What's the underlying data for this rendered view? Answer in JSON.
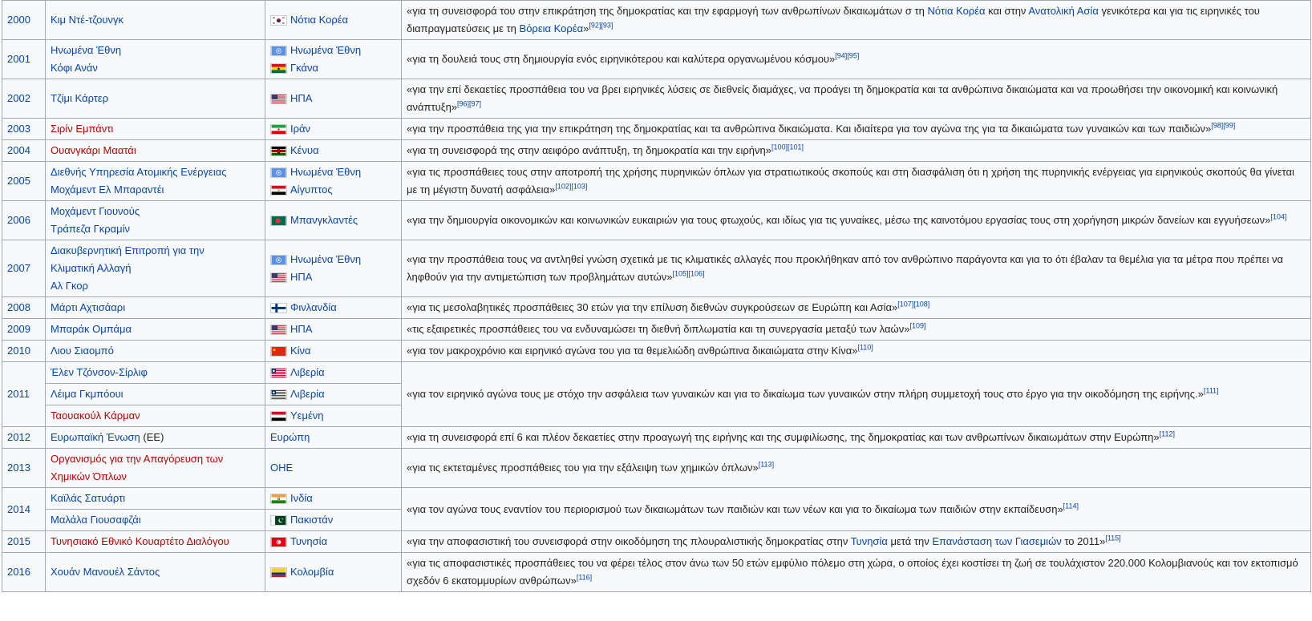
{
  "rows": [
    {
      "year": "2000",
      "names": [
        {
          "text": "Κιμ Ντέ-τζουνγκ",
          "cls": "blue"
        }
      ],
      "countries": [
        {
          "flag": "south-korea-flag",
          "text": "Νότια Κορέα"
        }
      ],
      "reason": [
        {
          "t": "«για τη συνεισφορά του στην επικράτηση της δημοκρατίας και την εφαρμογή των ανθρωπίνων δικαιωμάτων σ τη "
        },
        {
          "t": "Νότια Κορέα",
          "link": true
        },
        {
          "t": " και στην "
        },
        {
          "t": "Ανατολική Ασία",
          "link": true
        },
        {
          "t": " γενικότερα και για τις ειρηνικές του διαπραγματεύσεις με τη "
        },
        {
          "t": "Βόρεια Κορέα",
          "link": true
        },
        {
          "t": "»"
        }
      ],
      "refs": "[92][93]"
    },
    {
      "year": "2001",
      "names": [
        {
          "text": "Ηνωμένα Έθνη",
          "cls": "blue"
        },
        {
          "text": "Κόφι Ανάν",
          "cls": "blue"
        }
      ],
      "countries": [
        {
          "flag": "un-flag",
          "text": "Ηνωμένα Έθνη"
        },
        {
          "flag": "ghana-flag",
          "text": "Γκάνα"
        }
      ],
      "reason": [
        {
          "t": "«για τη δουλειά τους στη δημιουργία ενός ειρηνικότερου και καλύτερα οργανωμένου κόσμου»"
        }
      ],
      "refs": "[94][95]"
    },
    {
      "year": "2002",
      "names": [
        {
          "text": "Τζίμι Κάρτερ",
          "cls": "blue"
        }
      ],
      "countries": [
        {
          "flag": "usa-flag",
          "text": "ΗΠΑ"
        }
      ],
      "reason": [
        {
          "t": "«για την επί δεκαετίες προσπάθεια του να βρει ειρηνικές λύσεις σε διεθνείς διαμάχες, να προάγει τη δημοκρατία και τα ανθρώπινα δικαιώματα και να προωθήσει την οικονομική και κοινωνική ανάπτυξη»"
        }
      ],
      "refs": "[96][97]"
    },
    {
      "year": "2003",
      "names": [
        {
          "text": "Σιρίν Εμπάντι",
          "cls": "red"
        }
      ],
      "countries": [
        {
          "flag": "iran-flag",
          "text": "Ιράν"
        }
      ],
      "reason": [
        {
          "t": "«για την προσπάθεια της για την επικράτηση της δημοκρατίας και τα ανθρώπινα δικαιώματα. Και ιδιαίτερα για τον αγώνα της για τα δικαιώματα των γυναικών και των παιδιών»"
        }
      ],
      "refs": "[98][99]"
    },
    {
      "year": "2004",
      "names": [
        {
          "text": "Ουανγκάρι Μαατάι",
          "cls": "red"
        }
      ],
      "countries": [
        {
          "flag": "kenya-flag",
          "text": "Κένυα"
        }
      ],
      "reason": [
        {
          "t": "«για τη συνεισφορά της στην αειφόρο ανάπτυξη, τη δημοκρατία και την ειρήνη»"
        }
      ],
      "refs": "[100][101]"
    },
    {
      "year": "2005",
      "names": [
        {
          "text": "Διεθνής Υπηρεσία Ατομικής Ενέργειας",
          "cls": "blue"
        },
        {
          "text": "Μοχάμεντ Ελ Μπαραντέι",
          "cls": "blue"
        }
      ],
      "countries": [
        {
          "flag": "un-flag",
          "text": "Ηνωμένα Έθνη"
        },
        {
          "flag": "egypt-flag",
          "text": "Αίγυπτος"
        }
      ],
      "reason": [
        {
          "t": "«για τις προσπάθειες τους στην αποτροπή της χρήσης πυρηνικών όπλων για στρατιωτικούς σκοπούς και στη διασφάλιση ότι η χρήση της πυρηνικής ενέργειας για ειρηνικούς σκοπούς θα γίνεται με τη μέγιστη δυνατή ασφάλεια»"
        }
      ],
      "refs": "[102][103]"
    },
    {
      "year": "2006",
      "names": [
        {
          "text": "Μοχάμεντ Γιουνούς",
          "cls": "blue"
        },
        {
          "text": "Τράπεζα Γκραμίν",
          "cls": "blue"
        }
      ],
      "countries": [
        {
          "flag": "bangladesh-flag",
          "text": "Μπανγκλαντές"
        }
      ],
      "reason": [
        {
          "t": "«για την δημιουργία οικονομικών και κοινωνικών ευκαιριών για τους φτωχούς, και ιδίως για τις γυναίκες, μέσω της καινοτόμου εργασίας τους στη χορήγηση μικρών δανείων και εγγυήσεων»"
        }
      ],
      "refs": "[104]"
    },
    {
      "year": "2007",
      "names": [
        {
          "text": "Διακυβερνητική Επιτροπή για την",
          "cls": "blue"
        },
        {
          "text": "Κλιματική Αλλαγή",
          "cls": "blue"
        },
        {
          "text": "Αλ Γκορ",
          "cls": "blue"
        }
      ],
      "countries": [
        {
          "flag": "un-flag",
          "text": "Ηνωμένα Έθνη"
        },
        {
          "flag": "usa-flag",
          "text": "ΗΠΑ"
        }
      ],
      "reason": [
        {
          "t": "«για την προσπάθεια τους να αντληθεί γνώση σχετικά με τις κλιματικές αλλαγές που προκλήθηκαν από τον ανθρώπινο παράγοντα και για το ότι έβαλαν τα θεμέλια για τα μέτρα που πρέπει να ληφθούν για την αντιμετώπιση των προβλημάτων αυτών»"
        }
      ],
      "refs": "[105][106]"
    },
    {
      "year": "2008",
      "names": [
        {
          "text": "Μάρτι Αχτισάαρι",
          "cls": "blue"
        }
      ],
      "countries": [
        {
          "flag": "finland-flag",
          "text": "Φινλανδία"
        }
      ],
      "reason": [
        {
          "t": "«για τις μεσολαβητικές προσπάθειες 30 ετών για την επίλυση διεθνών συγκρούσεων σε Ευρώπη και Ασία»"
        }
      ],
      "refs": "[107][108]"
    },
    {
      "year": "2009",
      "names": [
        {
          "text": "Μπαράκ Ομπάμα",
          "cls": "blue"
        }
      ],
      "countries": [
        {
          "flag": "usa-flag",
          "text": "ΗΠΑ"
        }
      ],
      "reason": [
        {
          "t": "«τις εξαιρετικές προσπάθειες του να ενδυναμώσει τη διεθνή διπλωματία και τη συνεργασία μεταξύ των λαών»"
        }
      ],
      "refs": "[109]"
    },
    {
      "year": "2010",
      "names": [
        {
          "text": "Λιου Σιαομπό",
          "cls": "blue"
        }
      ],
      "countries": [
        {
          "flag": "china-flag",
          "text": "Κίνα"
        }
      ],
      "reason": [
        {
          "t": "«για τον μακροχρόνιο και ειρηνικό αγώνα του για τα θεμελιώδη ανθρώπινα δικαιώματα στην Κίνα»"
        }
      ],
      "refs": "[110]"
    },
    {
      "year": "2012",
      "names": [
        {
          "text": "Ευρωπαϊκή Ένωση",
          "cls": "blue",
          "suffix": " (ΕΕ)"
        }
      ],
      "countries": [
        {
          "flag": "",
          "text": "Ευρώπη"
        }
      ],
      "reason": [
        {
          "t": "«για τη συνεισφορά επί 6 και πλέον δεκαετίες στην προαγωγή της ειρήνης και της συμφιλίωσης, της δημοκρατίας και των ανθρωπίνων δικαιωμάτων στην Ευρώπη»"
        }
      ],
      "refs": "[112]"
    },
    {
      "year": "2013",
      "names": [
        {
          "text": "Οργανισμός για την Απαγόρευση των",
          "cls": "red"
        },
        {
          "text": "Χημικών Όπλων",
          "cls": "red"
        }
      ],
      "countries": [
        {
          "flag": "",
          "text": "ΟΗΕ"
        }
      ],
      "reason": [
        {
          "t": "«για τις εκτεταμένες προσπάθειες του για την εξάλειψη των χημικών όπλων»"
        }
      ],
      "refs": "[113]"
    },
    {
      "year": "2015",
      "names": [
        {
          "text": "Τυνησιακό Εθνικό Κουαρτέτο Διαλόγου",
          "cls": "red"
        }
      ],
      "countries": [
        {
          "flag": "tunisia-flag",
          "text": "Τυνησία"
        }
      ],
      "reason": [
        {
          "t": "«για την αποφασιστική του συνεισφορά στην οικοδόμηση της πλουραλιστικής δημοκρατίας στην "
        },
        {
          "t": "Τυνησία",
          "link": true
        },
        {
          "t": " μετά την "
        },
        {
          "t": "Επανάσταση των Γιασεμιών",
          "link": true
        },
        {
          "t": " το 2011»"
        }
      ],
      "refs": "[115]"
    },
    {
      "year": "2016",
      "names": [
        {
          "text": "Χουάν Μανουέλ Σάντος",
          "cls": "blue"
        }
      ],
      "countries": [
        {
          "flag": "colombia-flag",
          "text": "Κολομβία"
        }
      ],
      "reason": [
        {
          "t": "«για τις αποφασιστικές προσπάθειες του να φέρει τέλος στον άνω των 50 ετών εμφύλιο πόλεμο στη χώρα, ο οποίος έχει κοστίσει τη ζωή σε τουλάχιστον 220.000 Κολομβιανούς και τον εκτοπισμό σχεδόν 6 εκατομμυρίων ανθρώπων»"
        }
      ],
      "refs": "[116]"
    }
  ],
  "row2011": {
    "year": "2011",
    "laureates": [
      {
        "text": "Έλεν Τζόνσον-Σίρλιφ",
        "cls": "blue",
        "flag": "liberia-flag",
        "country": "Λιβερία"
      },
      {
        "text": "Λέιμα Γκμπόουι",
        "cls": "blue",
        "flag": "liberia-flag",
        "country": "Λιβερία"
      },
      {
        "text": "Ταουακούλ Κάρμαν",
        "cls": "red",
        "flag": "yemen-flag",
        "country": "Υεμένη"
      }
    ],
    "reason": "«για τον ειρηνικό αγώνα τους με στόχο την ασφάλεια των γυναικών και για το δικαίωμα των γυναικών στην πλήρη συμμετοχή τους στο έργο για την οικοδόμηση της ειρήνης.»",
    "refs": "[111]"
  },
  "row2014": {
    "year": "2014",
    "laureates": [
      {
        "text": "Καϊλάς Σατυάρτι",
        "cls": "blue",
        "flag": "india-flag",
        "country": "Ινδία"
      },
      {
        "text": "Μαλάλα Γιουσαφζάι",
        "cls": "blue",
        "flag": "pakistan-flag",
        "country": "Πακιστάν"
      }
    ],
    "reason": "«για τον αγώνα τους εναντίον του περιορισμού των δικαιωμάτων των παιδιών και των νέων και για το δικαίωμα των παιδιών στην εκπαίδευση»",
    "refs": "[114]"
  },
  "colors": {
    "link": "#0645ad",
    "redlink": "#ba0000",
    "cell_bg": "#f8f9fa",
    "border": "#a2a9b1"
  }
}
